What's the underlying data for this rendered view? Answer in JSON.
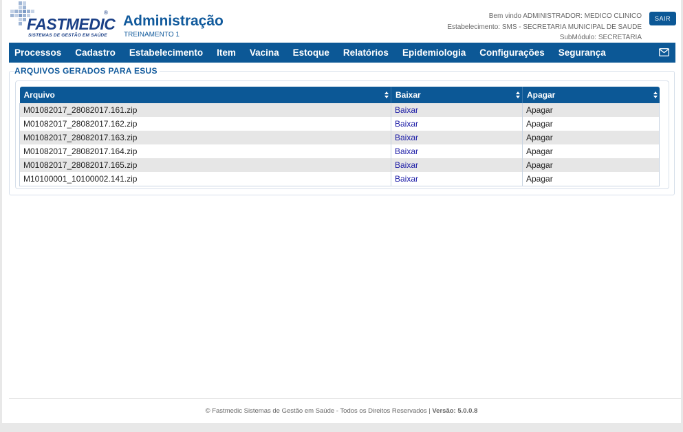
{
  "brand": {
    "logo_text": "FASTMEDIC",
    "logo_registered": "®",
    "logo_tagline": "SISTEMAS DE GESTÃO EM SAÚDE"
  },
  "header": {
    "title": "Administração",
    "subtitle": "TREINAMENTO 1",
    "welcome": "Bem vindo ADMINISTRADOR: MEDICO CLINICO",
    "establishment": "Estabelecimento: SMS - SECRETARIA MUNICIPAL DE SAUDE",
    "submodule": "SubMódulo: SECRETARIA",
    "logout_label": "SAIR"
  },
  "nav": {
    "items": [
      "Processos",
      "Cadastro",
      "Estabelecimento",
      "Item",
      "Vacina",
      "Estoque",
      "Relatórios",
      "Epidemiologia",
      "Configurações",
      "Segurança"
    ],
    "mail_icon": "envelope-icon"
  },
  "section": {
    "title": "ARQUIVOS GERADOS PARA ESUS"
  },
  "table": {
    "columns": [
      "Arquivo",
      "Baixar",
      "Apagar"
    ],
    "rows": [
      {
        "file": "M01082017_28082017.161.zip",
        "download": "Baixar",
        "delete": "Apagar"
      },
      {
        "file": "M01082017_28082017.162.zip",
        "download": "Baixar",
        "delete": "Apagar"
      },
      {
        "file": "M01082017_28082017.163.zip",
        "download": "Baixar",
        "delete": "Apagar"
      },
      {
        "file": "M01082017_28082017.164.zip",
        "download": "Baixar",
        "delete": "Apagar"
      },
      {
        "file": "M01082017_28082017.165.zip",
        "download": "Baixar",
        "delete": "Apagar"
      },
      {
        "file": "M10100001_10100002.141.zip",
        "download": "Baixar",
        "delete": "Apagar"
      }
    ]
  },
  "footer": {
    "text": "© Fastmedic Sistemas de Gestão em Saúde - Todos os Direitos Reservados | ",
    "version_label": "Versão: 5.0.0.8"
  },
  "colors": {
    "primary": "#0c5896",
    "title": "#115a9c",
    "link": "#1a1aa6",
    "row_alt": "#e6e6e6"
  }
}
